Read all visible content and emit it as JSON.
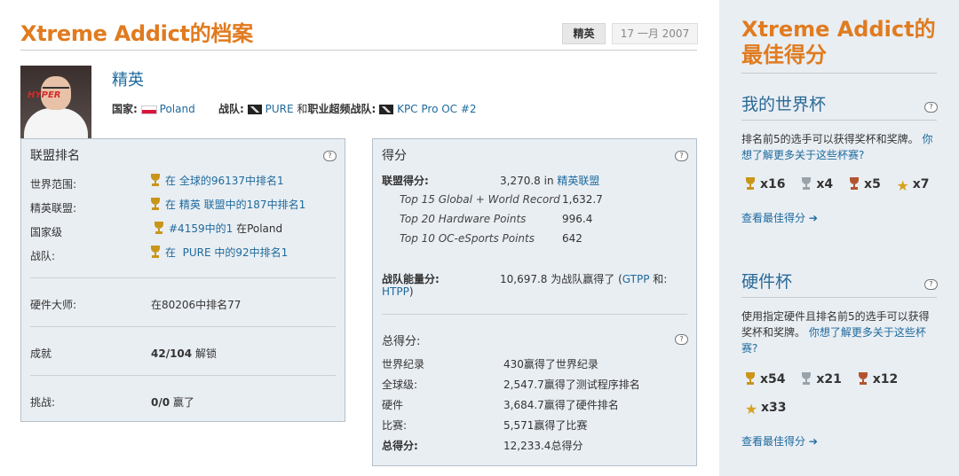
{
  "header": {
    "title": "Xtreme Addict的档案",
    "rank_tag": "精英",
    "date": "17 一月 2007"
  },
  "profile": {
    "rank_title": "精英",
    "country_label": "国家:",
    "country": "Poland",
    "team_label": "战队:",
    "team": "PURE",
    "and_text": "和",
    "pro_team_label": "职业超频战队:",
    "pro_team": "KPC Pro OC #2",
    "avatar_text": "HYPER"
  },
  "league_rank": {
    "title": "联盟排名",
    "rows": [
      {
        "label": "世界范围:",
        "prefix": "在",
        "value": "全球的96137中排名1"
      },
      {
        "label": "精英联盟:",
        "prefix": "在",
        "value": "精英 联盟中的187中排名1"
      },
      {
        "label": "国家级",
        "value": "#4159中的1",
        "suffix": "在Poland"
      },
      {
        "label": "战队:",
        "prefix": "在",
        "value": "PURE 中的92中排名1"
      }
    ],
    "hardware_label": "硬件大师:",
    "hardware_value": "在80206中排名77",
    "achievement_label": "成就",
    "achievement_value": "42/104",
    "achievement_suffix": "解锁",
    "challenge_label": "挑战:",
    "challenge_value": "0/0",
    "challenge_suffix": "赢了"
  },
  "score": {
    "title": "得分",
    "league_points_label": "联盟得分:",
    "league_points_value": "3,270.8",
    "league_points_in": "in",
    "league_points_league": "精英联盟",
    "sub_rows": [
      {
        "label": "Top 15 Global + World Record",
        "value": "1,632.7"
      },
      {
        "label": "Top 20 Hardware Points",
        "value": "996.4"
      },
      {
        "label": "Top 10 OC-eSports Points",
        "value": "642"
      }
    ],
    "team_power_label": "战队能量分:",
    "team_power_value": "10,697.8",
    "team_power_text": "为战队赢得了 (",
    "gtpp": "GTPP",
    "and": "和:",
    "htpp": "HTPP",
    "close_paren": ")",
    "total_title": "总得分:",
    "totals": [
      {
        "label": "世界纪录",
        "value": "430赢得了世界纪录"
      },
      {
        "label": "全球级:",
        "value": "2,547.7赢得了测试程序排名"
      },
      {
        "label": "硬件",
        "value": "3,684.7赢得了硬件排名"
      },
      {
        "label": "比赛:",
        "value": "5,571赢得了比赛"
      },
      {
        "label": "总得分:",
        "value": "12,233.4总得分"
      }
    ]
  },
  "sidebar": {
    "title": "Xtreme Addict的最佳得分",
    "world_cup": {
      "heading": "我的世界杯",
      "desc": "排名前5的选手可以获得奖杯和奖牌。",
      "link": "你想了解更多关于这些杯赛?",
      "counts": {
        "gold": "x16",
        "silver": "x4",
        "bronze": "x5",
        "star": "x7"
      },
      "view": "查看最佳得分"
    },
    "hardware_cup": {
      "heading": "硬件杯",
      "desc": "使用指定硬件且排名前5的选手可以获得奖杯和奖牌。",
      "link": "你想了解更多关于这些杯赛?",
      "counts": {
        "gold": "x54",
        "silver": "x21",
        "bronze": "x12",
        "star": "x33"
      },
      "view": "查看最佳得分"
    }
  }
}
